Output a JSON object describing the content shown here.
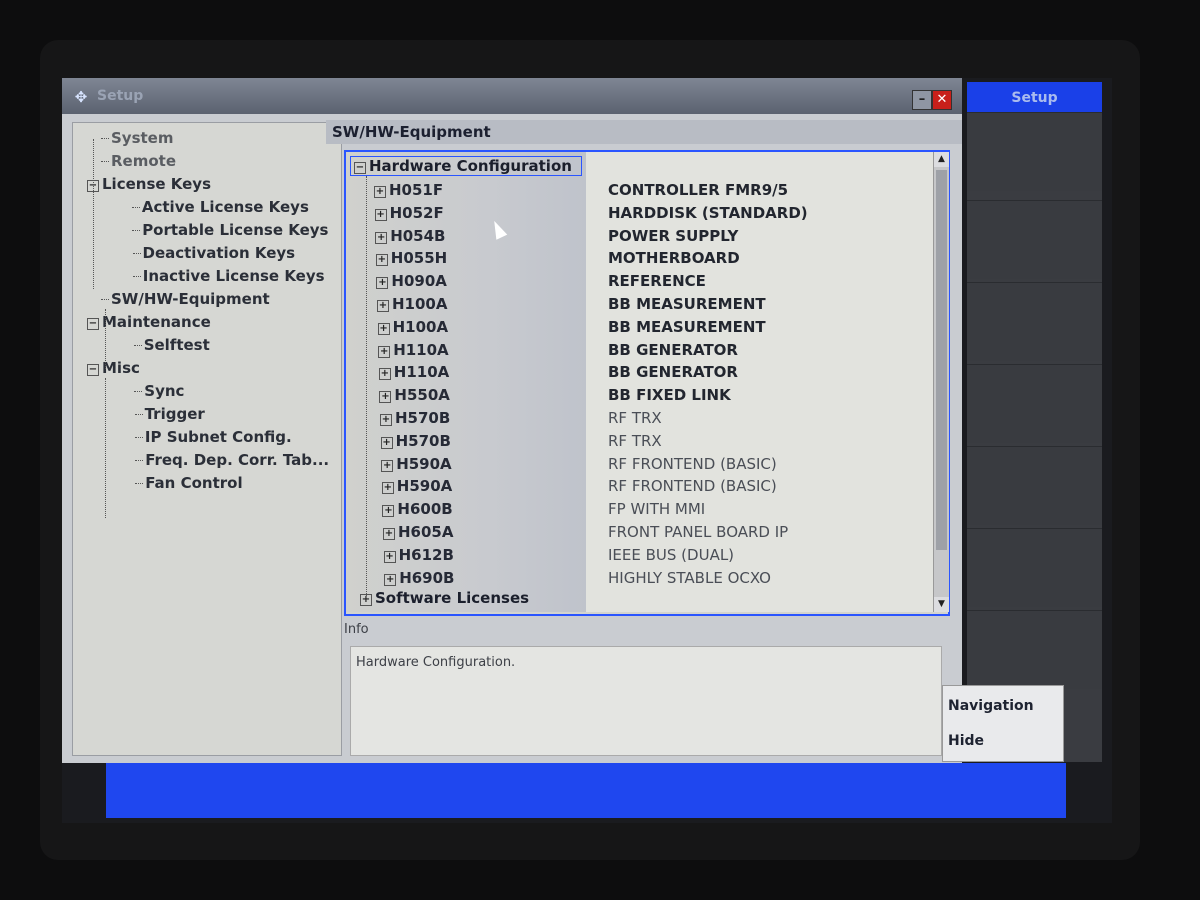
{
  "window": {
    "title": "Setup",
    "min_icon": "minimize-icon",
    "close_icon": "close-icon",
    "min_glyph": "–",
    "close_glyph": "✕"
  },
  "side_panel": {
    "title": "Setup",
    "softkeys": [
      "Navigation",
      "Hide"
    ]
  },
  "nav": {
    "items": [
      {
        "label": "System",
        "level": 0,
        "toggle": ""
      },
      {
        "label": "Remote",
        "level": 0,
        "toggle": ""
      },
      {
        "label": "License Keys",
        "level": 0,
        "toggle": "−"
      },
      {
        "label": "Active License Keys",
        "level": 1,
        "toggle": ""
      },
      {
        "label": "Portable License Keys",
        "level": 1,
        "toggle": ""
      },
      {
        "label": "Deactivation Keys",
        "level": 1,
        "toggle": ""
      },
      {
        "label": "Inactive License Keys",
        "level": 1,
        "toggle": ""
      },
      {
        "label": "SW/HW-Equipment",
        "level": 0,
        "toggle": ""
      },
      {
        "label": "Maintenance",
        "level": 0,
        "toggle": "−"
      },
      {
        "label": "Selftest",
        "level": 1,
        "toggle": ""
      },
      {
        "label": "Misc",
        "level": 0,
        "toggle": "−"
      },
      {
        "label": "Sync",
        "level": 1,
        "toggle": ""
      },
      {
        "label": "Trigger",
        "level": 1,
        "toggle": ""
      },
      {
        "label": "IP Subnet Config.",
        "level": 1,
        "toggle": ""
      },
      {
        "label": "Freq. Dep. Corr. Tab...",
        "level": 1,
        "toggle": ""
      },
      {
        "label": "Fan Control",
        "level": 1,
        "toggle": ""
      }
    ]
  },
  "content": {
    "title": "SW/HW-Equipment",
    "root_label": "Hardware Configuration",
    "root_toggle": "−",
    "child_toggle": "+",
    "rows": [
      {
        "id": "H051F",
        "desc": "CONTROLLER FMR9/5"
      },
      {
        "id": "H052F",
        "desc": "HARDDISK (STANDARD)"
      },
      {
        "id": "H054B",
        "desc": "POWER SUPPLY"
      },
      {
        "id": "H055H",
        "desc": "MOTHERBOARD"
      },
      {
        "id": "H090A",
        "desc": "REFERENCE"
      },
      {
        "id": "H100A",
        "desc": "BB MEASUREMENT"
      },
      {
        "id": "H100A",
        "desc": "BB MEASUREMENT"
      },
      {
        "id": "H110A",
        "desc": "BB GENERATOR"
      },
      {
        "id": "H110A",
        "desc": "BB GENERATOR"
      },
      {
        "id": "H550A",
        "desc": "BB FIXED LINK"
      },
      {
        "id": "H570B",
        "desc": "RF TRX"
      },
      {
        "id": "H570B",
        "desc": "RF TRX"
      },
      {
        "id": "H590A",
        "desc": "RF FRONTEND (BASIC)"
      },
      {
        "id": "H590A",
        "desc": "RF FRONTEND (BASIC)"
      },
      {
        "id": "H600B",
        "desc": "FP WITH MMI"
      },
      {
        "id": "H605A",
        "desc": "FRONT PANEL BOARD IP"
      },
      {
        "id": "H612B",
        "desc": "IEEE BUS (DUAL)"
      },
      {
        "id": "H690B",
        "desc": "HIGHLY STABLE OCXO"
      }
    ],
    "software_label": "Software Licenses",
    "software_toggle": "+",
    "scroll_up": "▲",
    "scroll_down": "▼"
  },
  "info": {
    "label": "Info",
    "text": "Hardware Configuration."
  },
  "colors": {
    "accent": "#1f47ef",
    "tree_border": "#2a55ff",
    "close_button": "#c8201a"
  }
}
